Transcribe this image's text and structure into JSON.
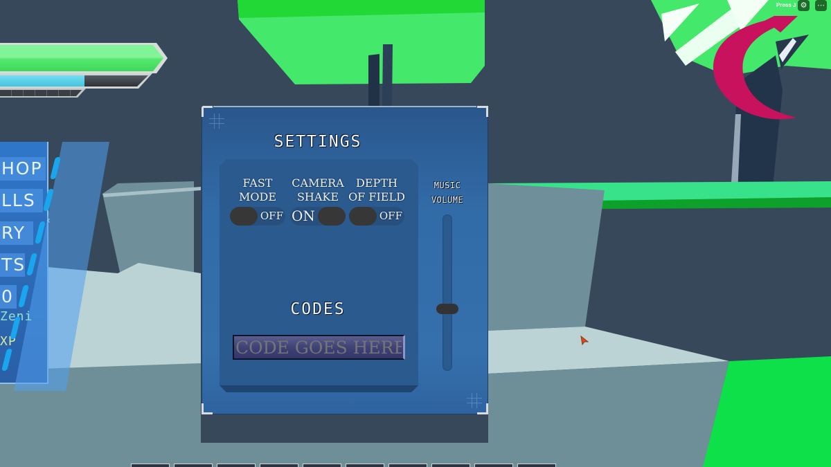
{
  "hud": {
    "health_fraction": 1.0,
    "mana_fraction": 0.57,
    "xp_segments": 8
  },
  "side_menu": {
    "items": [
      {
        "label": "SHOP",
        "visible_text": "HOP"
      },
      {
        "label": "SKILLS",
        "visible_text": "LLS"
      },
      {
        "label": "INVENTORY",
        "visible_text": "RY"
      },
      {
        "label": "STATS",
        "visible_text": "TS"
      },
      {
        "label": "",
        "visible_text": "0"
      }
    ],
    "stats": [
      {
        "visible_text": "Zeni",
        "color": "#8fe0d0"
      },
      {
        "visible_text": "XP",
        "color": "#d8e8a0"
      }
    ],
    "collapse_glyph": "‹"
  },
  "settings": {
    "title": "SETTINGS",
    "options": [
      {
        "label_line1": "FAST",
        "label_line2": "MODE",
        "state": "OFF",
        "on": false
      },
      {
        "label_line1": "CAMERA",
        "label_line2": "SHAKE",
        "state": "ON",
        "on": true
      },
      {
        "label_line1": "DEPTH",
        "label_line2": "OF FIELD",
        "state": "OFF",
        "on": false
      }
    ],
    "music_volume": {
      "label_line1": "MUSIC",
      "label_line2": "VOLUME",
      "value_fraction": 0.39
    },
    "codes": {
      "title": "CODES",
      "input_value": "",
      "input_placeholder": "CODE GOES HERE"
    }
  },
  "system": {
    "hint_text": "Press J",
    "settings_icon": "gear-icon",
    "menu_icon": "more-icon"
  },
  "hotbar": {
    "slot_count": 10
  },
  "colors": {
    "panel_blue": "#3570ac",
    "inner_blue": "#2b5a8e",
    "knob": "#373737",
    "health_green": "#54e86e",
    "mana_cyan": "#46c4e0",
    "grass_green": "#3cec6e",
    "arrow_magenta": "#c8125e"
  }
}
